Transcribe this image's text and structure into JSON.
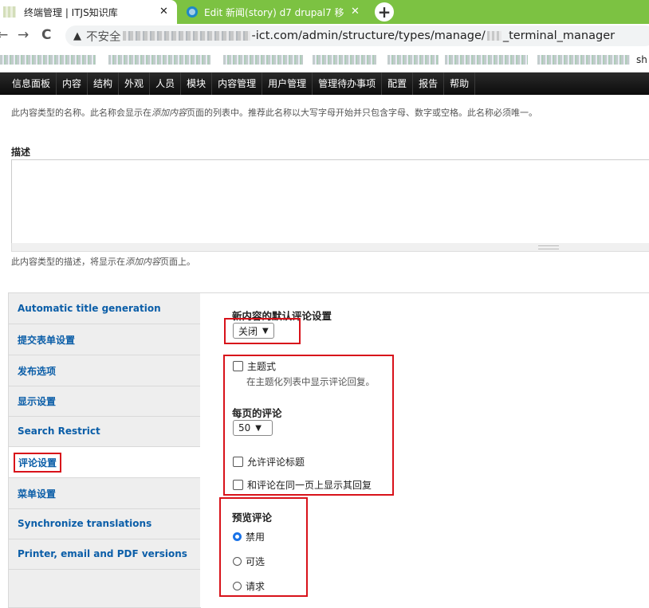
{
  "browser": {
    "tabs": [
      {
        "title": "终端管理 | ITJS知识库",
        "close": "✕"
      },
      {
        "title": "Edit 新闻(story) d7 drupal7 移",
        "close": "✕"
      }
    ],
    "new_tab": "+",
    "nav": {
      "back": "←",
      "forward": "→",
      "reload": "C"
    },
    "address": {
      "warning_icon": "▲",
      "insecure_label": "不安全",
      "url_visible_part": "-ict.com/admin/structure/types/manage/",
      "url_tail": "_terminal_manager"
    },
    "bookmarks_tail": "sh"
  },
  "admin_menu": [
    "信息面板",
    "内容",
    "结构",
    "外观",
    "人员",
    "模块",
    "内容管理",
    "用户管理",
    "管理待办事项",
    "配置",
    "报告",
    "帮助"
  ],
  "name_description": {
    "before": "此内容类型的名称。此名称会显示在",
    "em": "添加内容",
    "after": "页面的列表中。推荐此名称以大写字母开始并只包含字母、数字或空格。此名称必须唯一。"
  },
  "description_field": {
    "label": "描述",
    "value": ""
  },
  "description_help": {
    "before": "此内容类型的描述，将显示在",
    "em": "添加内容",
    "after": "页面上。"
  },
  "vertical_tabs": [
    {
      "label": "Automatic title generation",
      "active": false
    },
    {
      "label": "提交表单设置",
      "active": false
    },
    {
      "label": "发布选项",
      "active": false
    },
    {
      "label": "显示设置",
      "active": false
    },
    {
      "label": "Search Restrict",
      "active": false
    },
    {
      "label": "评论设置",
      "active": true
    },
    {
      "label": "菜单设置",
      "active": false
    },
    {
      "label": "Synchronize translations",
      "active": false
    },
    {
      "label": "Printer, email and PDF versions",
      "active": false
    }
  ],
  "comment_settings": {
    "default_title": "新内容的默认评论设置",
    "default_value": "关闭",
    "threaded_label": "主题式",
    "threaded_hint": "在主题化列表中显示评论回复。",
    "per_page_title": "每页的评论",
    "per_page_value": "50",
    "allow_title_label": "允许评论标题",
    "same_page_label": "和评论在同一页上显示其回复",
    "preview_title": "预览评论",
    "preview_options": [
      {
        "label": "禁用",
        "checked": true
      },
      {
        "label": "可选",
        "checked": false
      },
      {
        "label": "请求",
        "checked": false
      }
    ]
  },
  "colors": {
    "annotation_red": "#d8121a",
    "tab_link_blue": "#0b5ea8",
    "chrome_green": "#7cc242"
  }
}
